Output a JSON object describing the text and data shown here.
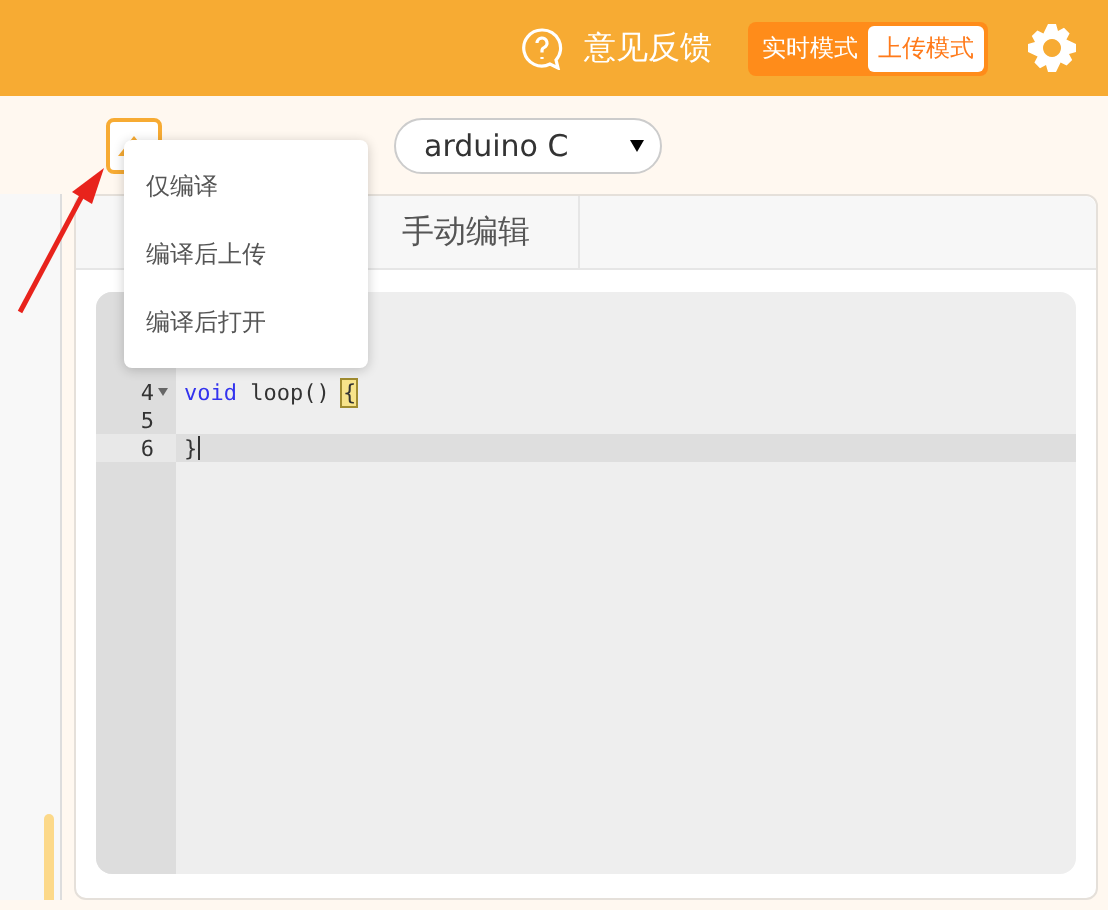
{
  "header": {
    "feedback": "意见反馈",
    "modes": [
      {
        "label": "实时模式",
        "selected": false
      },
      {
        "label": "上传模式",
        "selected": true
      }
    ]
  },
  "toolbar": {
    "language": "arduino C"
  },
  "upload_menu": {
    "items": [
      {
        "label": "仅编译"
      },
      {
        "label": "编译后上传"
      },
      {
        "label": "编译后打开"
      }
    ]
  },
  "tabs": [
    {
      "label": "手动编辑"
    }
  ],
  "code_lines": [
    {
      "number": "4",
      "fold": true,
      "active": false,
      "tokens": [
        {
          "text": "void",
          "kind": "keyword"
        },
        {
          "text": " loop() ",
          "kind": "plain"
        },
        {
          "text": "{",
          "kind": "bracket"
        }
      ]
    },
    {
      "number": "5",
      "fold": false,
      "active": false
    },
    {
      "number": "6",
      "fold": false,
      "active": true,
      "tokens": [
        {
          "text": "}",
          "kind": "plain"
        }
      ]
    }
  ]
}
